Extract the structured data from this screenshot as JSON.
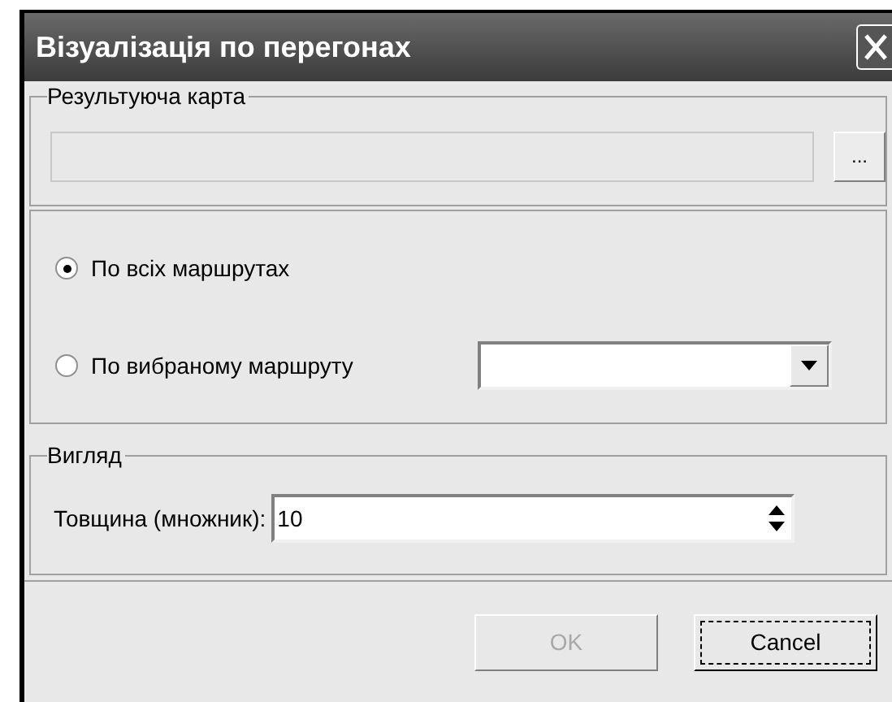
{
  "window": {
    "title": "Візуалізація по перегонах"
  },
  "result_map": {
    "legend": "Результуюча карта",
    "value_disabled": true,
    "browse_label": "..."
  },
  "routes": {
    "options": [
      {
        "label": "По всіх маршрутах",
        "selected": true
      },
      {
        "label": "По вибраному маршруту",
        "selected": false
      }
    ]
  },
  "view": {
    "legend": "Вигляд",
    "thickness_label": "Товщина (множник):",
    "thickness_value": "10"
  },
  "buttons": [
    {
      "label": "OK",
      "disabled": true,
      "focused": false
    },
    {
      "label": "Cancel",
      "disabled": false,
      "focused": true
    }
  ]
}
